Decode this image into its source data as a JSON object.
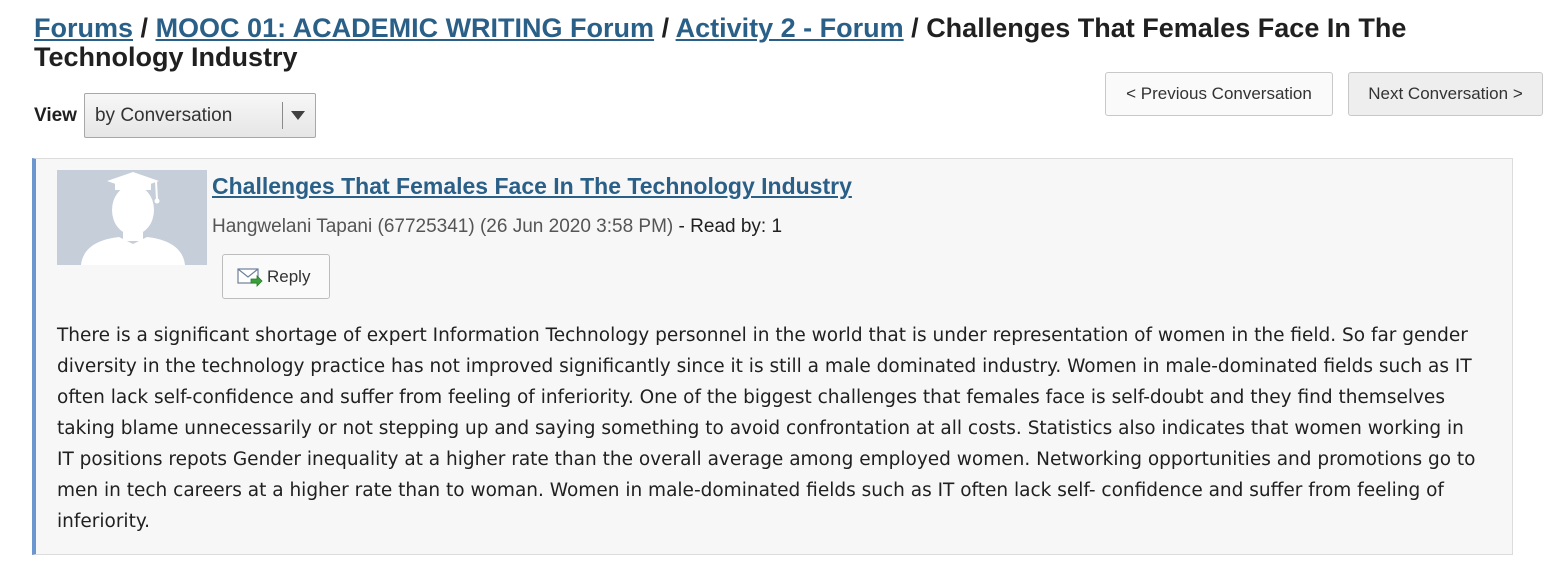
{
  "breadcrumb": {
    "forums": "Forums",
    "separator": "/",
    "course_forum": "MOOC 01: ACADEMIC WRITING Forum",
    "activity": "Activity 2 - Forum",
    "current": "Challenges That Females Face In The Technology Industry"
  },
  "view": {
    "label": "View",
    "selected": "by Conversation"
  },
  "navigation": {
    "previous_label": "< Previous Conversation",
    "next_label": "Next Conversation >"
  },
  "post": {
    "title": "Challenges That Females Face In The Technology Industry",
    "author": "Hangwelani Tapani (67725341)",
    "timestamp": "(26 Jun 2020 3:58 PM)",
    "read_by": "- Read by: 1",
    "reply_label": "Reply",
    "body": "There is a significant shortage of expert Information Technology personnel in the world that is under representation of women in the field. So far gender diversity in the technology practice has not improved significantly since it is still a male dominated industry. Women in male-dominated fields such as IT often lack self-confidence and suffer from feeling of inferiority. One of the biggest challenges that females face is self-doubt and they find themselves taking blame unnecessarily or not stepping up and saying something to avoid confrontation at all costs. Statistics also indicates that women working in IT positions repots Gender inequality at a higher rate than the overall average among employed women. Networking opportunities and promotions go to men in tech careers at a higher rate than to woman. Women in male-dominated fields such as IT often lack self- confidence and suffer from feeling of inferiority."
  },
  "icons": {
    "avatar": "graduate-avatar-placeholder-icon",
    "reply": "envelope-reply-icon",
    "dropdown": "caret-down-icon"
  },
  "colors": {
    "link": "#2a5f87",
    "post_accent": "#6b96d0",
    "post_background": "#f7f7f7"
  }
}
